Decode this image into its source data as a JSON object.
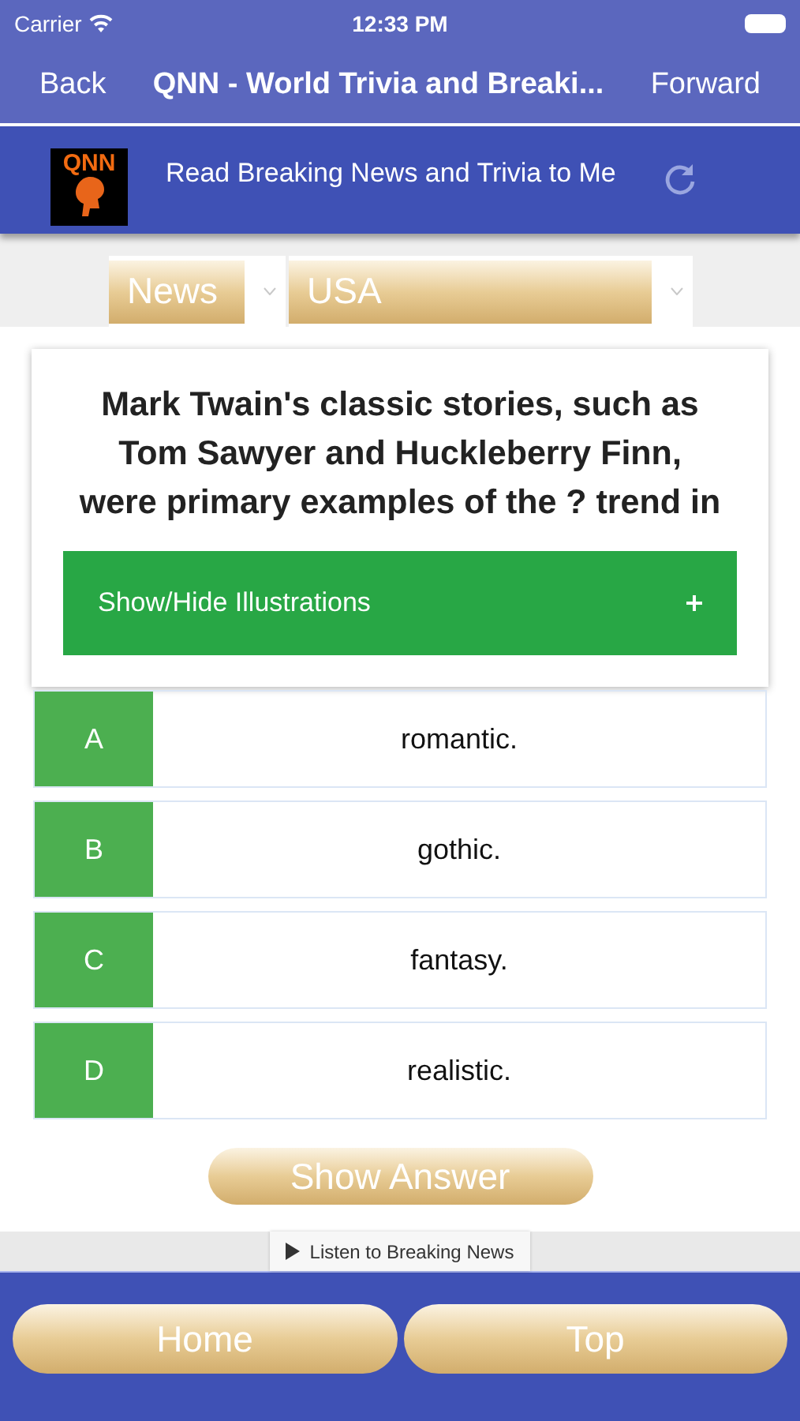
{
  "status_bar": {
    "carrier": "Carrier",
    "time": "12:33 PM"
  },
  "nav": {
    "back": "Back",
    "title": "QNN - World Trivia and Breaki...",
    "forward": "Forward"
  },
  "header": {
    "logo_text": "QNN",
    "read_button": "Read Breaking News and Trivia to Me"
  },
  "selects": [
    {
      "value": "News"
    },
    {
      "value": "USA"
    }
  ],
  "question": {
    "text": "Mark Twain's classic stories, such as Tom Sawyer and Huckleberry Finn, were primary examples of the ? trend in",
    "toggle": {
      "label": "Show/Hide Illustrations",
      "expanded": false
    }
  },
  "answers": [
    {
      "letter": "A",
      "text": "romantic."
    },
    {
      "letter": "B",
      "text": "gothic."
    },
    {
      "letter": "C",
      "text": "fantasy."
    },
    {
      "letter": "D",
      "text": "realistic."
    }
  ],
  "show_answer": "Show Answer",
  "listen_button": "Listen to Breaking News",
  "footer": [
    "Home",
    "Top"
  ]
}
